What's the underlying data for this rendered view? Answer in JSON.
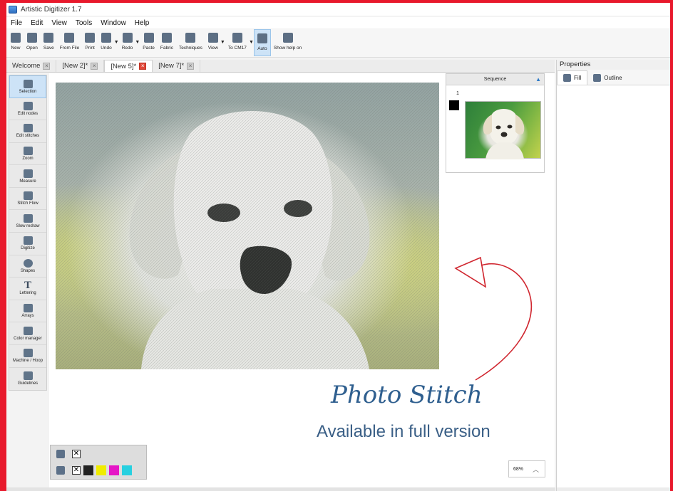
{
  "window": {
    "title": "Artistic Digitizer 1.7"
  },
  "menu": [
    "File",
    "Edit",
    "View",
    "Tools",
    "Window",
    "Help"
  ],
  "toolbar": [
    {
      "label": "New",
      "icon": "new-file-icon"
    },
    {
      "label": "Open",
      "icon": "open-folder-icon"
    },
    {
      "label": "Save",
      "icon": "save-icon"
    },
    {
      "label": "From File",
      "icon": "import-file-icon"
    },
    {
      "label": "Print",
      "icon": "print-icon"
    },
    {
      "label": "Undo",
      "icon": "undo-icon",
      "dropdown": true
    },
    {
      "label": "Redo",
      "icon": "redo-icon",
      "dropdown": true
    },
    {
      "label": "Paste",
      "icon": "paste-icon"
    },
    {
      "label": "Fabric",
      "icon": "fabric-icon"
    },
    {
      "label": "Techniques",
      "icon": "techniques-icon"
    },
    {
      "label": "View",
      "icon": "view-icon",
      "dropdown": true
    },
    {
      "label": "To CM17",
      "icon": "to-machine-icon",
      "dropdown": true
    },
    {
      "label": "Auto",
      "icon": "auto-icon",
      "active": true
    },
    {
      "label": "Show help on",
      "icon": "help-pointer-icon"
    }
  ],
  "tabs": [
    {
      "label": "Welcome",
      "active": false
    },
    {
      "label": "[New 2]*",
      "active": false
    },
    {
      "label": "[New 5]*",
      "active": true
    },
    {
      "label": "[New 7]*",
      "active": false
    }
  ],
  "tools": [
    {
      "label": "Selection",
      "icon": "selection-icon",
      "active": true
    },
    {
      "label": "Edit nodes",
      "icon": "edit-nodes-icon"
    },
    {
      "label": "Edit stitches",
      "icon": "edit-stitches-icon"
    },
    {
      "label": "Zoom",
      "icon": "zoom-icon"
    },
    {
      "label": "Measure",
      "icon": "measure-icon"
    },
    {
      "label": "Stitch Flow",
      "icon": "stitch-flow-icon"
    },
    {
      "label": "Slow redraw",
      "icon": "slow-redraw-icon"
    },
    {
      "label": "Digitize",
      "icon": "digitize-icon"
    },
    {
      "label": "Shapes",
      "icon": "shapes-icon"
    },
    {
      "label": "Lettering",
      "icon": "lettering-icon",
      "glyph": "T"
    },
    {
      "label": "Arrays",
      "icon": "arrays-icon"
    },
    {
      "label": "Color manager",
      "icon": "color-manager-icon"
    },
    {
      "label": "Machine / Hoop",
      "icon": "machine-hoop-icon"
    },
    {
      "label": "Guidelines",
      "icon": "guidelines-icon"
    }
  ],
  "sequence": {
    "title": "Sequence",
    "item_number": "1",
    "swatch_color": "#000000"
  },
  "watermark": {
    "title": "Photo Stitch",
    "subtitle": "Available in full version",
    "arrow_color": "#d0262f"
  },
  "palette": {
    "swatches": [
      "#222222",
      "#f0ec00",
      "#e516c6",
      "#27d0e0"
    ],
    "none_glyph": "✕"
  },
  "zoom": {
    "value": "68%"
  },
  "properties": {
    "title": "Properties",
    "tabs": [
      {
        "label": "Fill",
        "icon": "fill-bucket-icon",
        "active": true
      },
      {
        "label": "Outline",
        "icon": "outline-pen-icon",
        "active": false
      }
    ]
  }
}
